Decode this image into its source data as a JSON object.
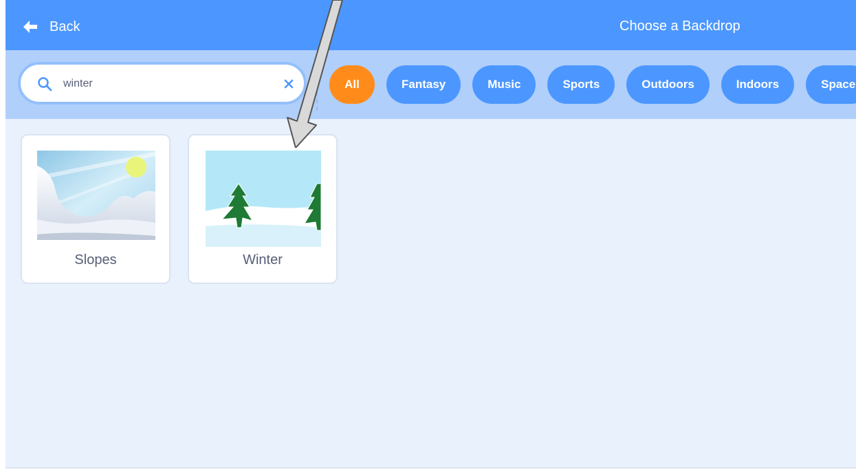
{
  "header": {
    "back_label": "Back",
    "title": "Choose a Backdrop",
    "back_icon": "arrow-left-icon"
  },
  "search": {
    "value": "winter",
    "icon": "search-icon",
    "clear_icon": "close-icon"
  },
  "tags": [
    {
      "label": "All",
      "active": true
    },
    {
      "label": "Fantasy"
    },
    {
      "label": "Music"
    },
    {
      "label": "Sports"
    },
    {
      "label": "Outdoors"
    },
    {
      "label": "Indoors"
    },
    {
      "label": "Space"
    }
  ],
  "backdrops": [
    {
      "name": "Slopes"
    },
    {
      "name": "Winter"
    }
  ],
  "colors": {
    "header": "#4c97ff",
    "filterbar": "#b0cffb",
    "active_tag": "#ff8c1a",
    "tag": "#4c97ff",
    "background": "#e8f1fc"
  }
}
